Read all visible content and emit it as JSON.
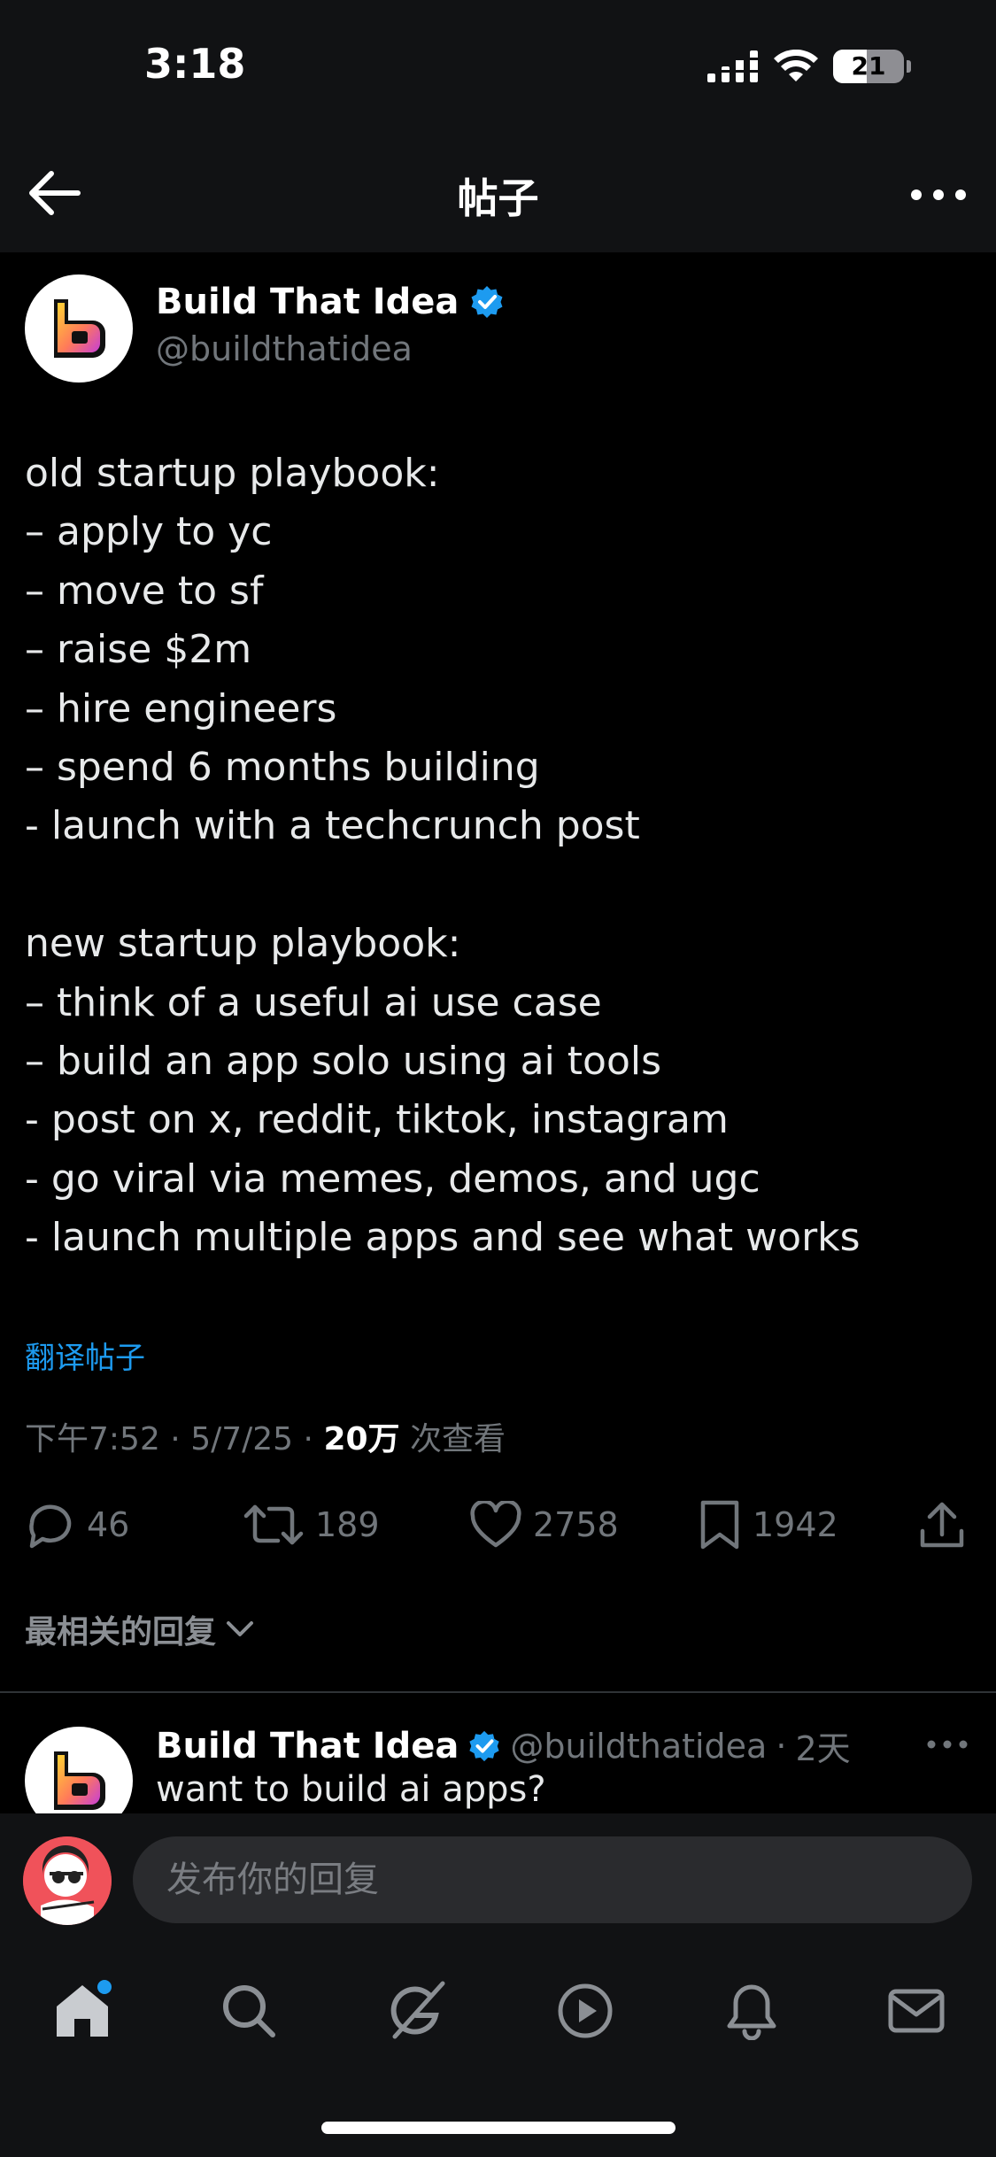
{
  "status_bar": {
    "time": "3:18",
    "battery": "21"
  },
  "nav": {
    "title": "帖子"
  },
  "post": {
    "author_name": "Build That Idea",
    "author_handle": "@buildthatidea",
    "lines": [
      "old startup playbook:",
      "– apply to yc",
      "– move to sf",
      "– raise $2m",
      "– hire engineers",
      "– spend 6 months building",
      "- launch with a techcrunch post",
      "",
      "new startup playbook:",
      "– think of a useful ai use case",
      "– build an app solo using ai tools",
      "- post on x, reddit, tiktok, instagram",
      "- go viral via memes, demos, and ugc",
      "- launch multiple apps and see what works"
    ],
    "translate_label": "翻译帖子",
    "time": "下午7:52",
    "date": "5/7/25",
    "views_count": "20万",
    "views_label": "次查看",
    "separator": "·"
  },
  "actions": {
    "replies": "46",
    "reposts": "189",
    "likes": "2758",
    "bookmarks": "1942"
  },
  "replies_filter": {
    "label": "最相关的回复"
  },
  "reply_preview": {
    "author_name": "Build That Idea",
    "author_handle": "@buildthatidea",
    "separator": "·",
    "age": "2天",
    "text": "want to build ai apps?"
  },
  "composer": {
    "placeholder": "发布你的回复"
  },
  "tab_bar": {
    "items": [
      "home-icon",
      "search-icon",
      "grok-icon",
      "video-icon",
      "notifications-icon",
      "messages-icon"
    ],
    "active": "home-icon"
  },
  "colors": {
    "background": "#000000",
    "accent": "#1d9bf0",
    "secondary_text": "#71767b",
    "verified": "#1d9bf0"
  }
}
